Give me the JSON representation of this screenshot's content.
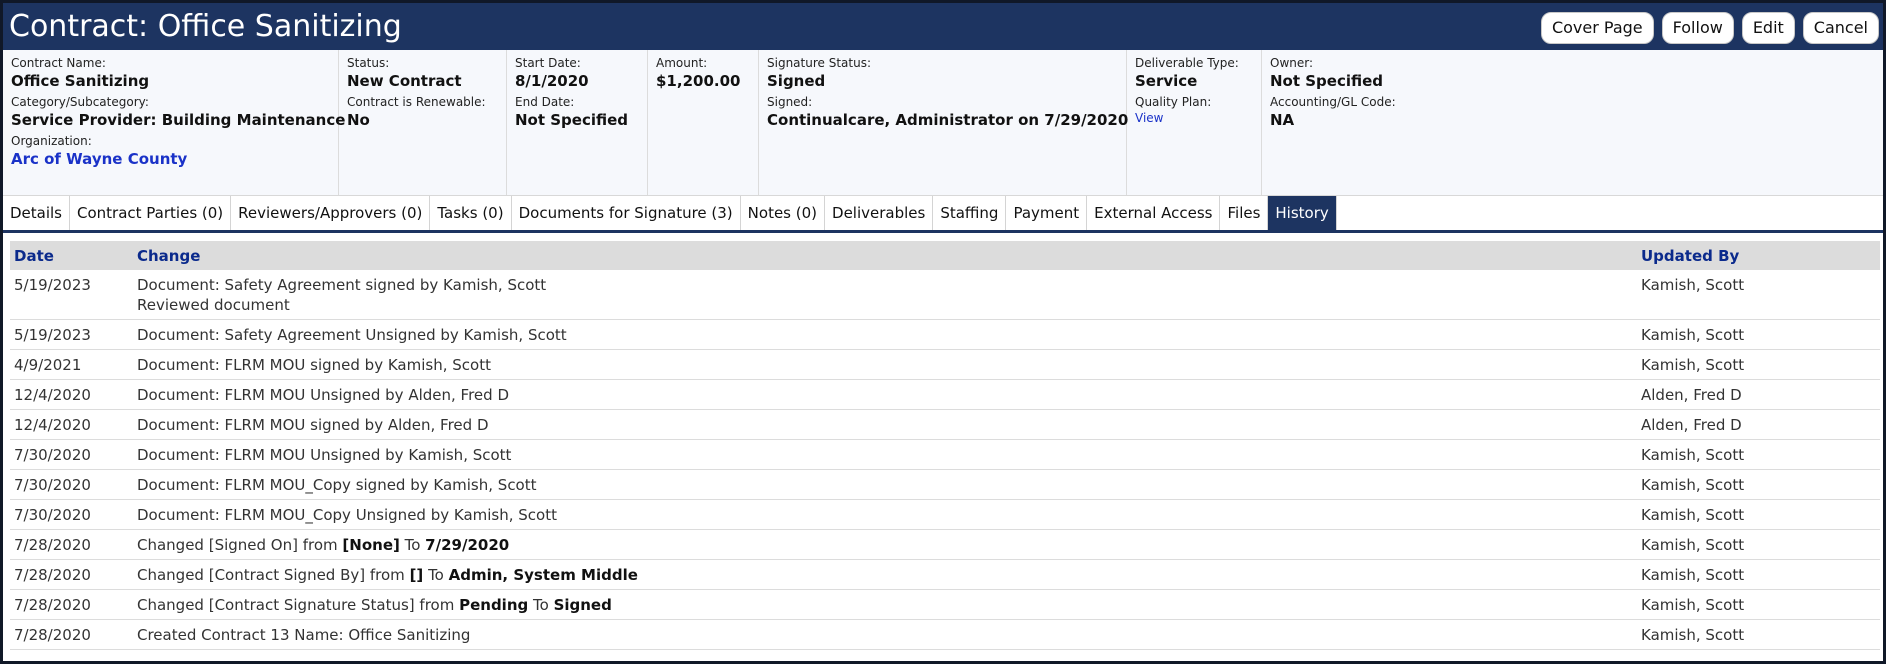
{
  "header": {
    "title": "Contract: Office Sanitizing",
    "buttons": [
      "Cover Page",
      "Follow",
      "Edit",
      "Cancel"
    ]
  },
  "summary": {
    "contract_name_label": "Contract Name:",
    "contract_name": "Office Sanitizing",
    "category_label": "Category/Subcategory:",
    "category": "Service Provider: Building Maintenance",
    "organization_label": "Organization:",
    "organization": "Arc of Wayne County",
    "status_label": "Status:",
    "status": "New Contract",
    "renewable_label": "Contract is Renewable:",
    "renewable": "No",
    "start_label": "Start Date:",
    "start": "8/1/2020",
    "end_label": "End Date:",
    "end": "Not Specified",
    "amount_label": "Amount:",
    "amount": "$1,200.00",
    "sig_status_label": "Signature Status:",
    "sig_status": "Signed",
    "signed_label": "Signed:",
    "signed": "Continualcare, Administrator on 7/29/2020",
    "deliverable_label": "Deliverable Type:",
    "deliverable": "Service",
    "quality_label": "Quality Plan:",
    "quality_link": "View",
    "owner_label": "Owner:",
    "owner": "Not Specified",
    "gl_label": "Accounting/GL Code:",
    "gl": "NA"
  },
  "tabs": [
    {
      "label": "Details",
      "active": false
    },
    {
      "label": "Contract Parties (0)",
      "active": false
    },
    {
      "label": "Reviewers/Approvers (0)",
      "active": false
    },
    {
      "label": "Tasks (0)",
      "active": false
    },
    {
      "label": "Documents for Signature (3)",
      "active": false
    },
    {
      "label": "Notes (0)",
      "active": false
    },
    {
      "label": "Deliverables",
      "active": false
    },
    {
      "label": "Staffing",
      "active": false
    },
    {
      "label": "Payment",
      "active": false
    },
    {
      "label": "External Access",
      "active": false
    },
    {
      "label": "Files",
      "active": false
    },
    {
      "label": "History",
      "active": true
    }
  ],
  "history": {
    "columns": [
      "Date",
      "Change",
      "Updated By"
    ],
    "rows": [
      {
        "date": "5/19/2023",
        "change": [
          {
            "t": "Document: Safety Agreement signed by Kamish, Scott"
          }
        ],
        "note": "Reviewed document",
        "by": "Kamish, Scott"
      },
      {
        "date": "5/19/2023",
        "change": [
          {
            "t": "Document: Safety Agreement Unsigned by Kamish, Scott"
          }
        ],
        "by": "Kamish, Scott"
      },
      {
        "date": "4/9/2021",
        "change": [
          {
            "t": "Document: FLRM MOU signed by Kamish, Scott"
          }
        ],
        "by": "Kamish, Scott"
      },
      {
        "date": "12/4/2020",
        "change": [
          {
            "t": "Document: FLRM MOU Unsigned by Alden, Fred D"
          }
        ],
        "by": "Alden, Fred D"
      },
      {
        "date": "12/4/2020",
        "change": [
          {
            "t": "Document: FLRM MOU signed by Alden, Fred D"
          }
        ],
        "by": "Alden, Fred D"
      },
      {
        "date": "7/30/2020",
        "change": [
          {
            "t": "Document: FLRM MOU Unsigned by Kamish, Scott"
          }
        ],
        "by": "Kamish, Scott"
      },
      {
        "date": "7/30/2020",
        "change": [
          {
            "t": "Document: FLRM MOU_Copy signed by Kamish, Scott"
          }
        ],
        "by": "Kamish, Scott"
      },
      {
        "date": "7/30/2020",
        "change": [
          {
            "t": "Document: FLRM MOU_Copy Unsigned by Kamish, Scott"
          }
        ],
        "by": "Kamish, Scott"
      },
      {
        "date": "7/28/2020",
        "change": [
          {
            "t": "Changed [Signed On] from "
          },
          {
            "b": "[None]"
          },
          {
            "t": " To "
          },
          {
            "b": "7/29/2020"
          }
        ],
        "by": "Kamish, Scott"
      },
      {
        "date": "7/28/2020",
        "change": [
          {
            "t": "Changed [Contract Signed By] from "
          },
          {
            "b": "[]"
          },
          {
            "t": " To "
          },
          {
            "b": "Admin, System Middle"
          }
        ],
        "by": "Kamish, Scott"
      },
      {
        "date": "7/28/2020",
        "change": [
          {
            "t": "Changed [Contract Signature Status] from "
          },
          {
            "b": "Pending"
          },
          {
            "t": " To "
          },
          {
            "b": "Signed"
          }
        ],
        "by": "Kamish, Scott"
      },
      {
        "date": "7/28/2020",
        "change": [
          {
            "t": "Created Contract 13 Name: Office Sanitizing"
          }
        ],
        "by": "Kamish, Scott"
      }
    ]
  },
  "colors": {
    "header_bg": "#1d3461",
    "link": "#1a32c8",
    "table_header_text": "#0b2a8c"
  }
}
